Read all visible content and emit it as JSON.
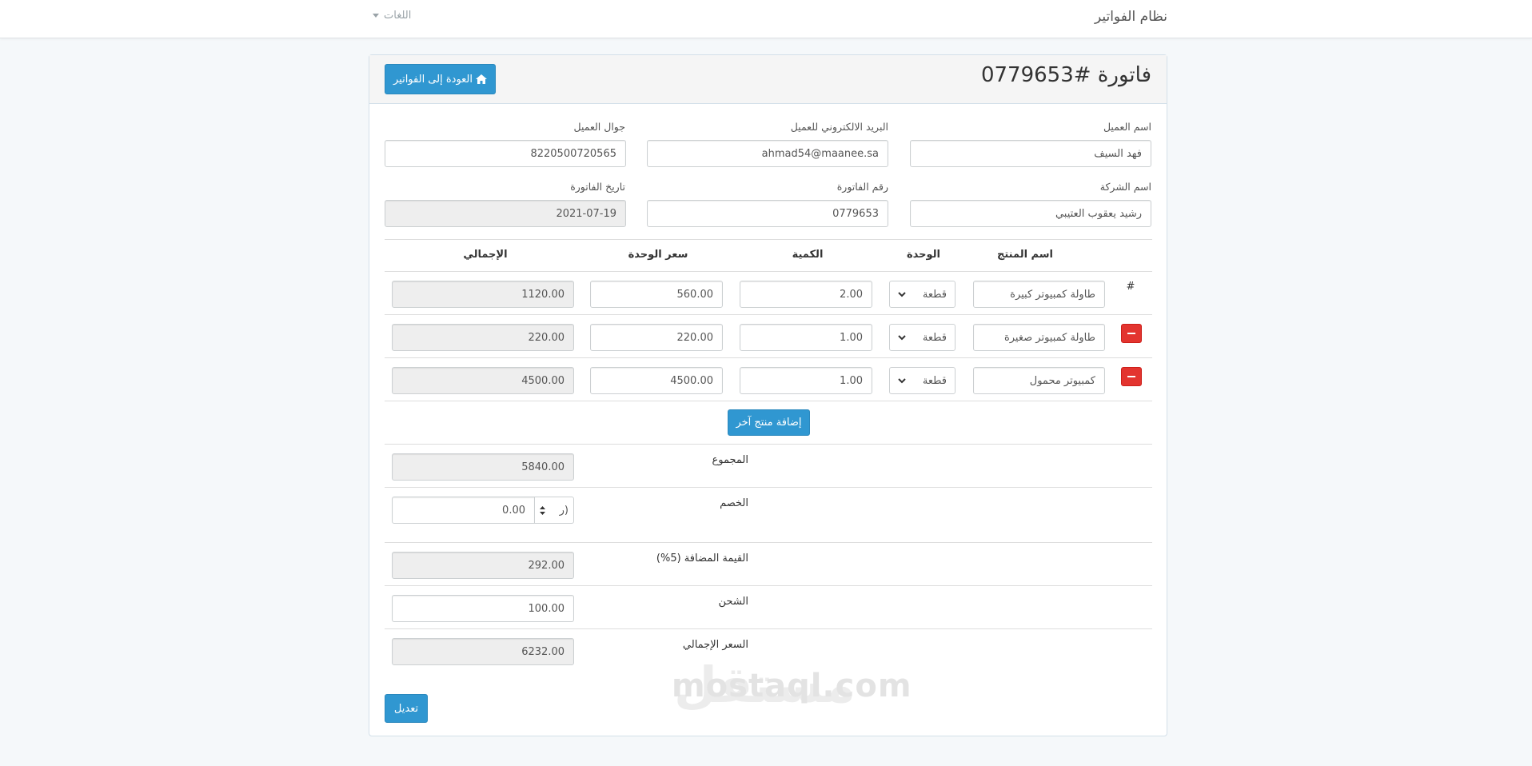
{
  "navbar": {
    "brand": "نظام الفواتير",
    "languages": "اللغات"
  },
  "invoice": {
    "title": "فاتورة #0779653",
    "back_button": "العودة إلى الفواتير",
    "fields": {
      "customer_name": {
        "label": "اسم العميل",
        "value": "فهد السيف"
      },
      "customer_email": {
        "label": "البريد الالكتروني للعميل",
        "value": "ahmad54@maanee.sa"
      },
      "customer_mobile": {
        "label": "جوال العميل",
        "value": "8220500720565"
      },
      "company_name": {
        "label": "اسم الشركة",
        "value": "رشيد يعقوب العتيبي"
      },
      "invoice_number": {
        "label": "رقم الفاتورة",
        "value": "0779653"
      },
      "invoice_date": {
        "label": "تاريخ الفاتورة",
        "value": "2021-07-19"
      }
    },
    "table": {
      "headers": {
        "index": "#",
        "product": "اسم المنتج",
        "unit": "الوحدة",
        "qty": "الكمية",
        "price": "سعر الوحدة",
        "total": "الإجمالي"
      },
      "rows": [
        {
          "product": "طاولة كمبيوتر كبيرة",
          "unit": "قطعة",
          "qty": "2.00",
          "price": "560.00",
          "total": "1120.00"
        },
        {
          "product": "طاولة كمبيوتر صغيرة",
          "unit": "قطعة",
          "qty": "1.00",
          "price": "220.00",
          "total": "220.00"
        },
        {
          "product": "كمبيوتر محمول",
          "unit": "قطعة",
          "qty": "1.00",
          "price": "4500.00",
          "total": "4500.00"
        }
      ]
    },
    "add_product": "إضافة منتج آخر",
    "summary": {
      "subtotal_label": "المجموع",
      "subtotal": "5840.00",
      "discount_label": "الخصم",
      "discount_type": "(ر",
      "discount": "0.00",
      "vat_label": "القيمة المضافة (5%)",
      "vat": "292.00",
      "shipping_label": "الشحن",
      "shipping": "100.00",
      "grand_total_label": "السعر الإجمالي",
      "grand_total": "6232.00"
    },
    "edit_button": "تعديل"
  },
  "watermark": {
    "arabic": "مستقل",
    "latin": "mostaql.com"
  }
}
